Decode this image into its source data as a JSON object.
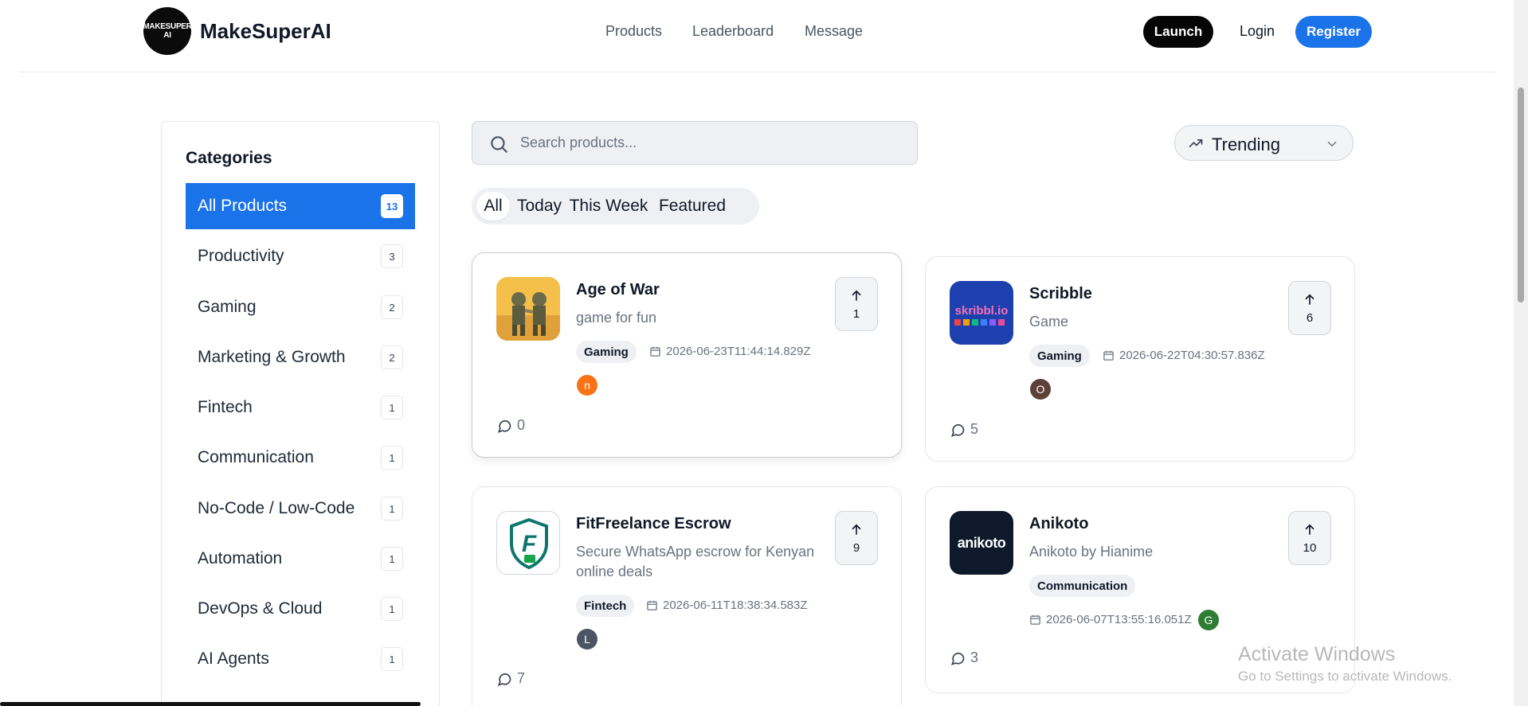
{
  "header": {
    "logo_text": "MAKESUPER AI",
    "brand": "MakeSuperAI",
    "nav": [
      "Products",
      "Leaderboard",
      "Message"
    ],
    "launch_label": "Launch",
    "login_label": "Login",
    "register_label": "Register"
  },
  "sidebar": {
    "title": "Categories",
    "items": [
      {
        "label": "All Products",
        "count": "13"
      },
      {
        "label": "Productivity",
        "count": "3"
      },
      {
        "label": "Gaming",
        "count": "2"
      },
      {
        "label": "Marketing & Growth",
        "count": "2"
      },
      {
        "label": "Fintech",
        "count": "1"
      },
      {
        "label": "Communication",
        "count": "1"
      },
      {
        "label": "No-Code / Low-Code",
        "count": "1"
      },
      {
        "label": "Automation",
        "count": "1"
      },
      {
        "label": "DevOps & Cloud",
        "count": "1"
      },
      {
        "label": "AI Agents",
        "count": "1"
      }
    ]
  },
  "search": {
    "placeholder": "Search products..."
  },
  "sort": {
    "label": "Trending"
  },
  "tabs": [
    "All",
    "Today",
    "This Week",
    "Featured"
  ],
  "products": [
    {
      "title": "Age of War",
      "desc": "game for fun",
      "tag": "Gaming",
      "date": "2026-06-23T11:44:14.829Z",
      "avatar": "n",
      "avatar_color": "#f97316",
      "comments": "0",
      "votes": "1"
    },
    {
      "title": "Scribble",
      "desc": "Game",
      "tag": "Gaming",
      "date": "2026-06-22T04:30:57.836Z",
      "avatar": "O",
      "avatar_color": "#5d4037",
      "comments": "5",
      "votes": "6"
    },
    {
      "title": "FitFreelance Escrow",
      "desc": "Secure WhatsApp escrow for Kenyan online deals",
      "tag": "Fintech",
      "date": "2026-06-11T18:38:34.583Z",
      "avatar": "L",
      "avatar_color": "#4b5563",
      "comments": "7",
      "votes": "9"
    },
    {
      "title": "Anikoto",
      "desc": "Anikoto by Hianime",
      "tag": "Communication",
      "date": "2026-06-07T13:55:16.051Z",
      "avatar": "G",
      "avatar_color": "#2e7d32",
      "comments": "3",
      "votes": "10",
      "logo_text": "anikoto"
    }
  ],
  "watermark": {
    "line1": "Activate Windows",
    "line2": "Go to Settings to activate Windows."
  },
  "colors": {
    "accent": "#1a73e8",
    "launch": "#050505"
  }
}
